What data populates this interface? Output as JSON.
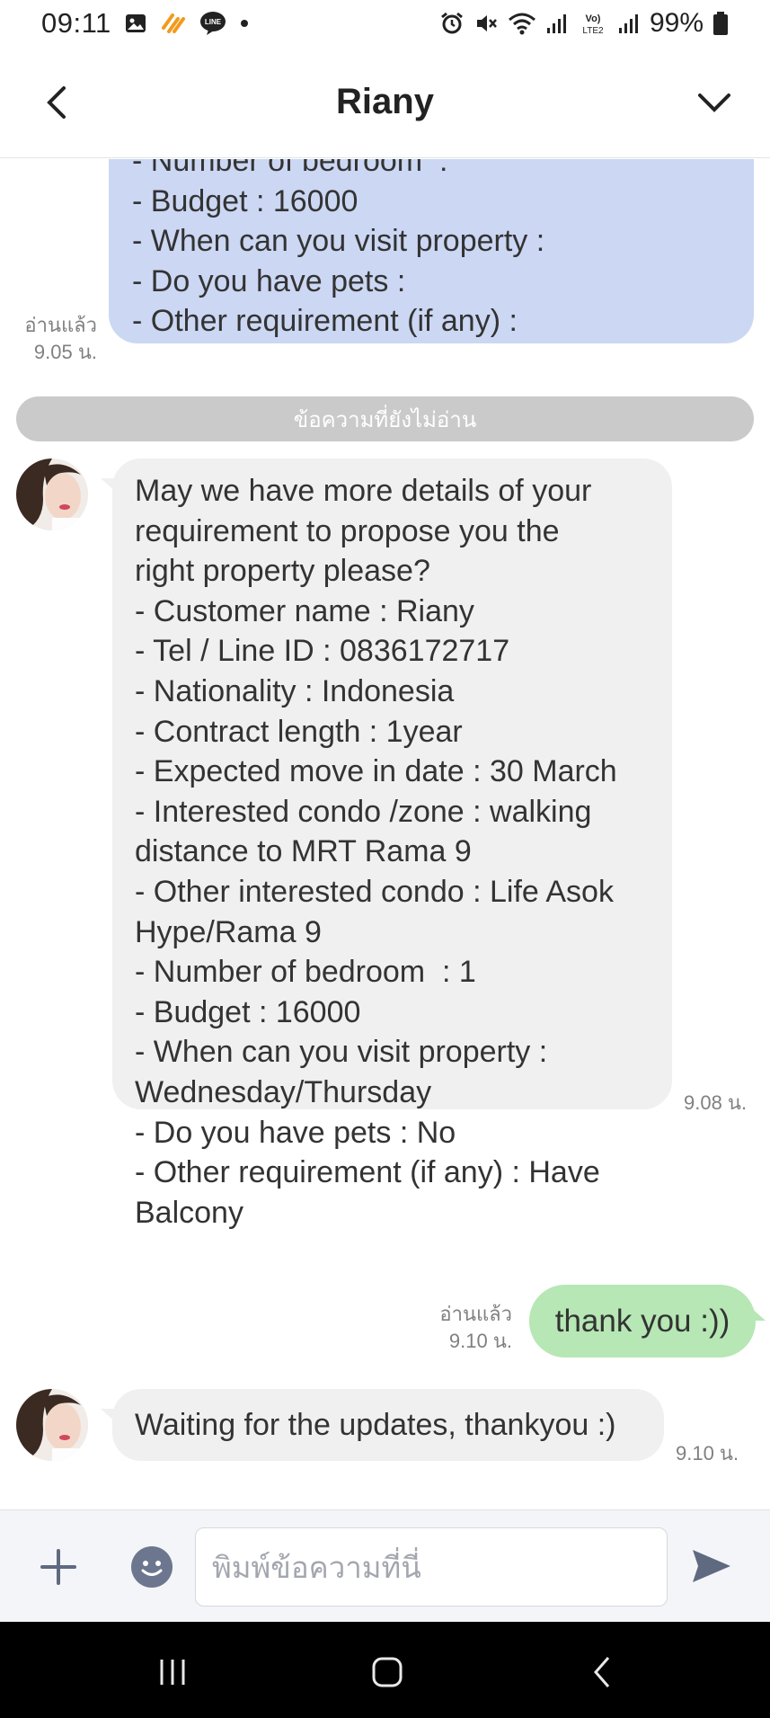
{
  "status_bar": {
    "time": "09:11",
    "battery": "99%",
    "left_icons": [
      "gallery-icon",
      "app-notification-icon",
      "line-app-icon",
      "dot-icon"
    ],
    "right_icons": [
      "alarm-icon",
      "mute-icon",
      "wifi-icon",
      "signal-icon",
      "volte-icon",
      "signal-icon",
      "battery-icon"
    ]
  },
  "header": {
    "title": "Riany"
  },
  "chat": {
    "previous_message": {
      "lines": [
        "- Number of bedroom  :",
        "- Budget : 16000",
        "- When can you visit property :",
        "- Do you have pets :",
        "- Other requirement (if any) :"
      ],
      "read_status": "อ่านแล้ว",
      "time": "9.05 น."
    },
    "unread_divider": "ข้อความที่ยังไม่อ่าน",
    "incoming_details": {
      "lines": [
        "May we have more details of your",
        "requirement to propose you the",
        "right property please?",
        "- Customer name : Riany",
        "- Tel / Line ID : 0836172717",
        "- Nationality : Indonesia",
        "- Contract length : 1year",
        "- Expected move in date : 30 March",
        "- Interested condo /zone : walking",
        "distance to MRT Rama 9",
        "- Other interested condo : Life Asok",
        "Hype/Rama 9",
        "- Number of bedroom  : 1",
        "- Budget : 16000",
        "- When can you visit property :",
        "Wednesday/Thursday",
        "- Do you have pets : No",
        "- Other requirement (if any) : Have",
        "Balcony"
      ],
      "time": "9.08 น."
    },
    "outgoing_thanks": {
      "text": "thank you :))",
      "read_status": "อ่านแล้ว",
      "time": "9.10 น."
    },
    "incoming_waiting": {
      "text": "Waiting for the updates, thankyou :)",
      "time": "9.10 น."
    }
  },
  "input_bar": {
    "placeholder": "พิมพ์ข้อความที่นี่"
  },
  "colors": {
    "outgoing_bubble": "#cbd7f3",
    "outgoing_bubble_green": "#b6e7b4",
    "incoming_bubble": "#f0f0f1",
    "unread_divider": "#cacaca"
  }
}
